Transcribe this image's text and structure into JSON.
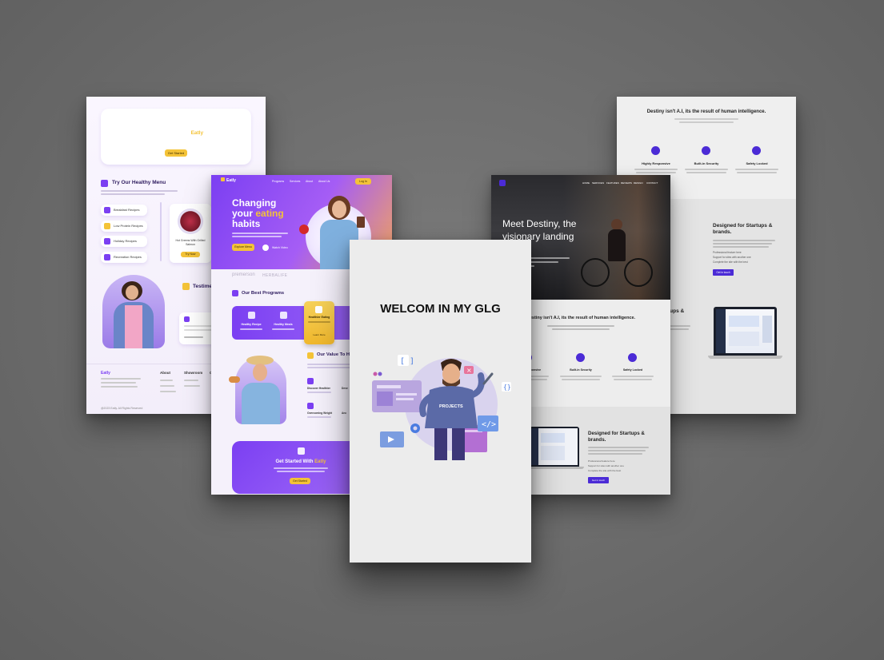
{
  "eatly_menu": {
    "cta_title_prefix": "Get Started With ",
    "cta_title_brand": "Eatly",
    "cta_button": "Get Started",
    "menu_heading": "Try Our Healthy Menu",
    "menu_items": [
      "Breakfast Recipes",
      "Low Protein Recipes",
      "Holiday Recipes",
      "Recreation Recipes"
    ],
    "dish_name": "Hot Greens With Grilled Salmon",
    "dish_button": "Try Now",
    "testimonial_heading": "Testime",
    "footer_brand": "Eatly",
    "footer_cols": [
      "About",
      "Showroom",
      "Co"
    ],
    "copyright": "@2023 Eatly. All Rights Reserved"
  },
  "eatly_hero": {
    "brand": "Eatly",
    "nav": [
      "Programs",
      "Services",
      "About",
      "About Us"
    ],
    "nav_button": "Log In",
    "headline_1": "Changing",
    "headline_2a": "your ",
    "headline_2b": "eating",
    "headline_3": "habits",
    "hero_button": "Explore Menu",
    "hero_link": "Watch Video",
    "partners": [
      "premerson",
      "HERBALIFE"
    ],
    "programs_heading": "Our Best Programs",
    "programs": [
      "Healthy Recipe",
      "Healthy Meals",
      "Healthier Eating",
      "Hea"
    ],
    "programs_button": "Learn More",
    "value_heading": "Our Value To H",
    "values": [
      "Discover Healthier",
      "Overcoming Weight",
      "Deve",
      "Anc"
    ],
    "cta_title_prefix": "Get Started With ",
    "cta_title_brand": "Eatly",
    "cta_button": "Get Started"
  },
  "destiny_back": {
    "title": "Destiny isn't A.I, its the result of human intelligence.",
    "features": [
      "Highly Responsive",
      "Built-in Security",
      "Safety Locked"
    ],
    "startup_heading_1": "Designed for Startups &",
    "startup_heading_2": "brands.",
    "startup_heading_short": "tups &",
    "list": [
      "Professional feature here",
      "Support for sites with another one",
      "Complete the site with the best"
    ],
    "button": "Get in touch"
  },
  "destiny_front": {
    "nav": [
      "HOME",
      "SERVICES",
      "FEATURES",
      "REVIEWS",
      "DESIGN",
      "CONTACT"
    ],
    "hero_1": "Meet Destiny, the",
    "hero_2": "visionary landing",
    "title": "Destiny isn't A.I, its the result of human intelligence.",
    "features": [
      "Highly Responsive",
      "Built-in Security",
      "Safety Locked"
    ],
    "startup_heading_1": "Designed for Startups &",
    "startup_heading_2": "brands.",
    "list": [
      "Professional feature here",
      "Support for sites with another one",
      "Complete the site with the best"
    ],
    "button": "Get in touch"
  },
  "glg": {
    "title": "WELCOM IN MY GLG",
    "shirt_text": "PROJECTS"
  },
  "colors": {
    "background": "#6b6b6b",
    "eatly_purple": "#7b3ff2",
    "eatly_yellow": "#f4c338",
    "destiny_indigo": "#4b2bd6"
  }
}
